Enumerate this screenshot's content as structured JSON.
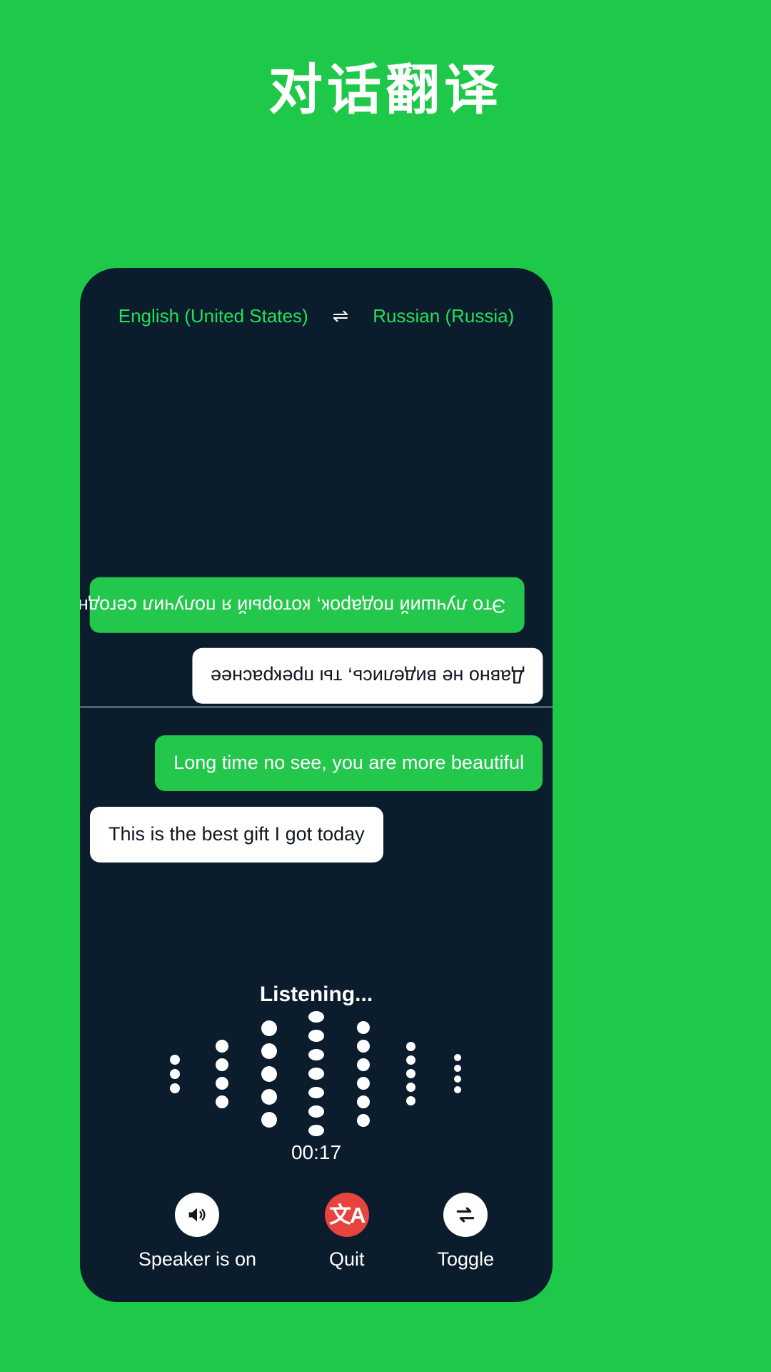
{
  "page": {
    "title": "对话翻译",
    "background_color": "#1ec94a"
  },
  "card": {
    "background_color": "#0b1c2c",
    "languages": {
      "source": "English (United States)",
      "swap_icon": "⇌",
      "target": "Russian (Russia)",
      "color": "#22e058"
    },
    "conversation_top": {
      "messages": [
        {
          "text": "Это лучший подарок, который я получил сегодня",
          "style": "green",
          "align": "left",
          "rotated": true
        },
        {
          "text": "Давно не виделись, ты прекраснее",
          "style": "white",
          "align": "right",
          "rotated": true
        }
      ]
    },
    "conversation_bottom": {
      "messages": [
        {
          "text": "Long time no see, you are more beautiful",
          "style": "green",
          "align": "right",
          "rotated": false
        },
        {
          "text": "This is the best gift I got today",
          "style": "white",
          "align": "left",
          "rotated": false
        }
      ]
    },
    "listening": {
      "label": "Listening...",
      "timer": "00:17",
      "waveform": {
        "columns": [
          {
            "dots": 3,
            "size": 14
          },
          {
            "dots": 4,
            "size": 18
          },
          {
            "dots": 5,
            "size": 22
          },
          {
            "dots": 7,
            "size": 22
          },
          {
            "dots": 6,
            "size": 18
          },
          {
            "dots": 5,
            "size": 13
          },
          {
            "dots": 4,
            "size": 10
          }
        ],
        "color": "#ffffff"
      }
    },
    "controls": [
      {
        "label": "Speaker is on",
        "icon": "speaker-icon",
        "circle": "white",
        "color": "#ffffff"
      },
      {
        "label": "Quit",
        "icon": "translate-icon",
        "circle": "red",
        "color": "#e8443f"
      },
      {
        "label": "Toggle",
        "icon": "swap-icon",
        "circle": "white",
        "color": "#ffffff"
      }
    ]
  }
}
